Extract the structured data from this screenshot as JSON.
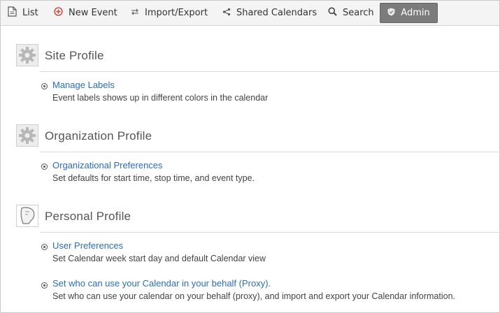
{
  "toolbar": {
    "list_label": "List",
    "new_event_label": "New Event",
    "import_export_label": "Import/Export",
    "shared_calendars_label": "Shared Calendars",
    "search_label": "Search",
    "admin_label": "Admin"
  },
  "sections": [
    {
      "title": "Site Profile",
      "icon": "gear-icon",
      "items": [
        {
          "link": "Manage Labels",
          "description": "Event labels shows up in different colors in the calendar"
        }
      ]
    },
    {
      "title": "Organization Profile",
      "icon": "gear-icon",
      "items": [
        {
          "link": "Organizational Preferences",
          "description": "Set defaults for start time, stop time, and event type."
        }
      ]
    },
    {
      "title": "Personal Profile",
      "icon": "personal-profile-icon",
      "items": [
        {
          "link": "User Preferences",
          "description": "Set Calendar week start day and default Calendar view"
        },
        {
          "link": "Set who can use your Calendar in your behalf (Proxy).",
          "description": "Set who can use your calendar on your behalf (proxy), and import and export your Calendar information."
        }
      ]
    }
  ],
  "colors": {
    "link": "#2a6db8",
    "admin_button": "#7b7b7b",
    "new_event_icon": "#d9342b"
  }
}
